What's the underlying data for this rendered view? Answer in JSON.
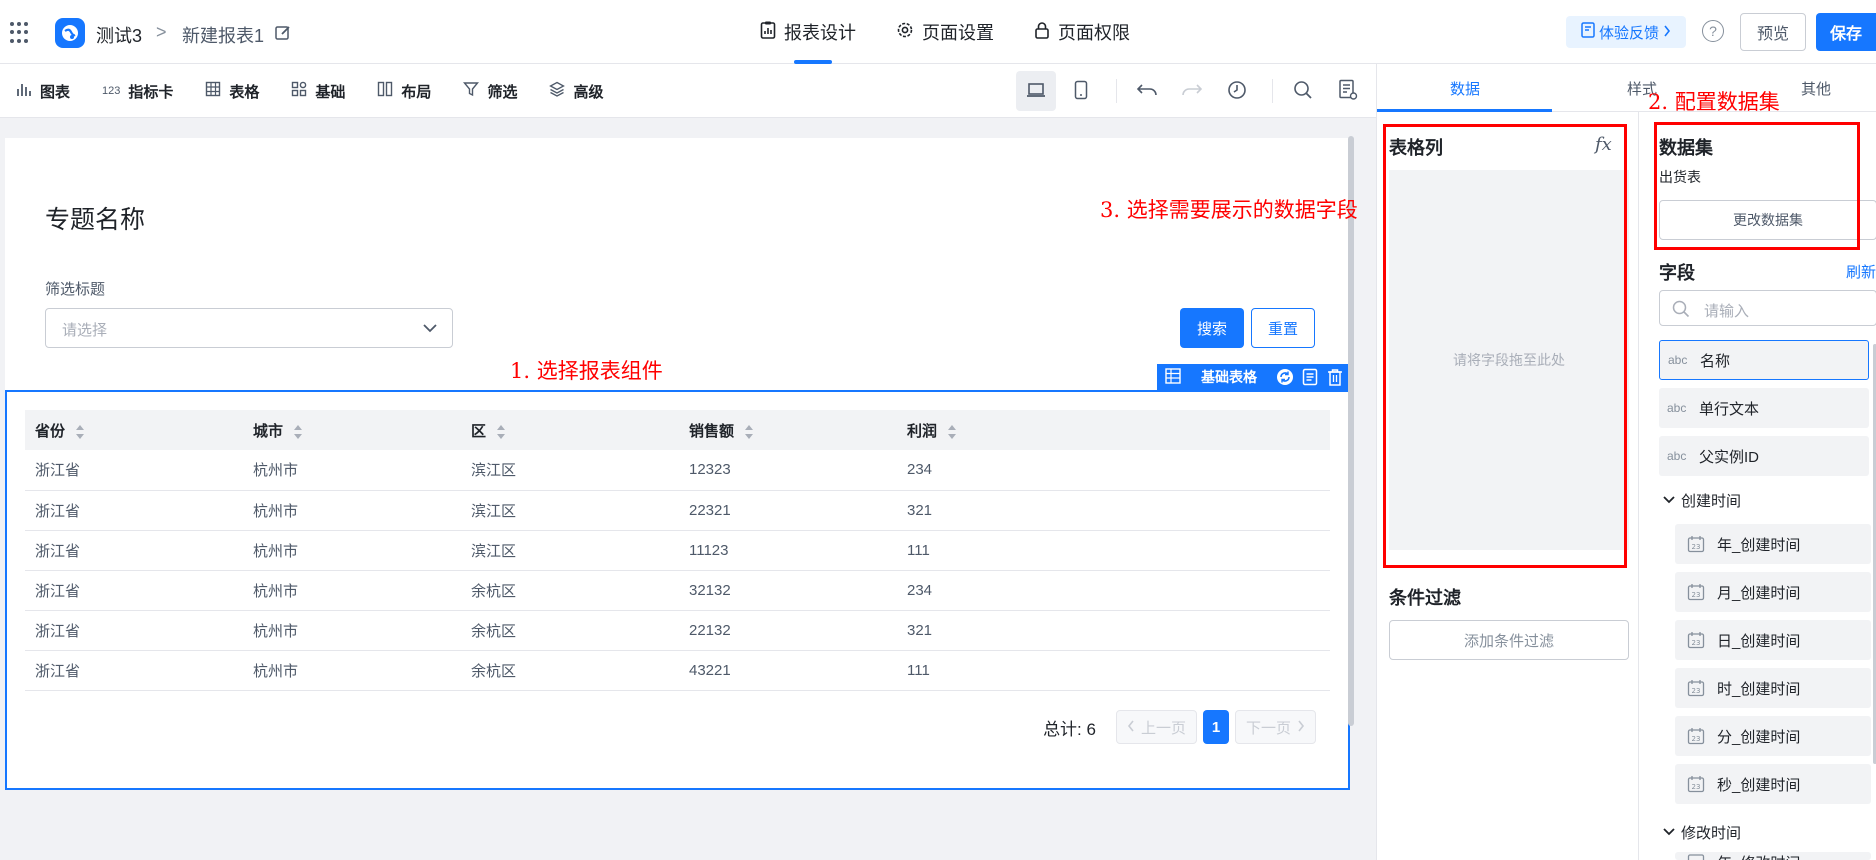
{
  "header": {
    "app_name": "测试3",
    "separator": ">",
    "report_name": "新建报表1",
    "tabs": [
      {
        "label": "报表设计",
        "icon": "report-icon"
      },
      {
        "label": "页面设置",
        "icon": "gear-icon"
      },
      {
        "label": "页面权限",
        "icon": "lock-icon"
      }
    ],
    "active_tab": "报表设计",
    "feedback_label": "体验反馈",
    "help_label": "?",
    "preview_label": "预览",
    "save_label": "保存"
  },
  "toolbar": {
    "items": [
      {
        "label": "图表",
        "icon": "bar-chart-icon"
      },
      {
        "label": "指标卡",
        "icon": "metric-card-icon"
      },
      {
        "label": "表格",
        "icon": "table-icon"
      },
      {
        "label": "基础",
        "icon": "grid-icon"
      },
      {
        "label": "布局",
        "icon": "layout-icon"
      },
      {
        "label": "筛选",
        "icon": "filter-icon"
      },
      {
        "label": "高级",
        "icon": "layers-icon"
      }
    ],
    "metric_icon_text": "123"
  },
  "canvas": {
    "topic_title": "专题名称",
    "filter_label": "筛选标题",
    "filter_placeholder": "请选择",
    "search_label": "搜索",
    "reset_label": "重置",
    "widget_tag": "基础表格",
    "table": {
      "columns": [
        "省份",
        "城市",
        "区",
        "销售额",
        "利润"
      ],
      "rows": [
        [
          "浙江省",
          "杭州市",
          "滨江区",
          "12323",
          "234"
        ],
        [
          "浙江省",
          "杭州市",
          "滨江区",
          "22321",
          "321"
        ],
        [
          "浙江省",
          "杭州市",
          "滨江区",
          "11123",
          "111"
        ],
        [
          "浙江省",
          "杭州市",
          "余杭区",
          "32132",
          "234"
        ],
        [
          "浙江省",
          "杭州市",
          "余杭区",
          "22132",
          "321"
        ],
        [
          "浙江省",
          "杭州市",
          "余杭区",
          "43221",
          "111"
        ]
      ]
    },
    "pager": {
      "total": "总计: 6",
      "prev": "上一页",
      "page": "1",
      "next": "下一页"
    }
  },
  "right_panel": {
    "tabs": [
      "数据",
      "样式",
      "其他"
    ],
    "active_tab": "数据",
    "columns_title": "表格列",
    "fx_label": "fx",
    "drop_hint": "请将字段拖至此处",
    "condition_title": "条件过滤",
    "add_condition": "添加条件过滤",
    "dataset_title": "数据集",
    "dataset_name": "出货表",
    "change_dataset": "更改数据集",
    "fields_title": "字段",
    "refresh_label": "刷新",
    "field_search_placeholder": "请输入",
    "fields": [
      {
        "type": "abc",
        "name": "名称"
      },
      {
        "type": "abc",
        "name": "单行文本"
      },
      {
        "type": "abc",
        "name": "父实例ID"
      }
    ],
    "groups": [
      {
        "name": "创建时间",
        "items": [
          "年_创建时间",
          "月_创建时间",
          "日_创建时间",
          "时_创建时间",
          "分_创建时间",
          "秒_创建时间"
        ]
      },
      {
        "name": "修改时间",
        "items": [
          "年_修改时间"
        ]
      }
    ]
  },
  "annotations": {
    "step1": "1. 选择报表组件",
    "step2": "2. 配置数据集",
    "step3": "3. 选择需要展示的数据字段",
    "color": "#ff0000"
  },
  "colors": {
    "primary": "#1677ff",
    "annotation": "#ff0000"
  }
}
